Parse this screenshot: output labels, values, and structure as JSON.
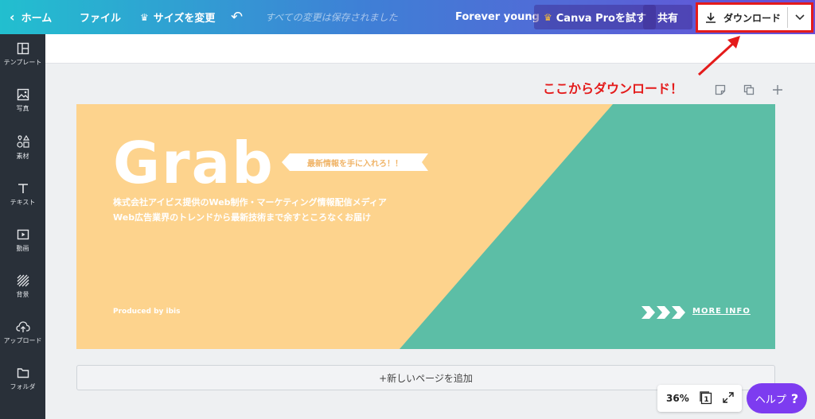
{
  "topbar": {
    "home_label": "ホーム",
    "file_label": "ファイル",
    "resize_label": "サイズを変更",
    "saved_status": "すべての変更は保存されました",
    "doc_title": "Forever young",
    "pro_label": "Canva Proを試す",
    "share_label": "共有",
    "download_label": "ダウンロード"
  },
  "sidebar": {
    "items": [
      {
        "label": "テンプレート",
        "icon": "template-icon"
      },
      {
        "label": "写真",
        "icon": "photo-icon"
      },
      {
        "label": "素材",
        "icon": "elements-icon"
      },
      {
        "label": "テキスト",
        "icon": "text-icon"
      },
      {
        "label": "動画",
        "icon": "video-icon"
      },
      {
        "label": "背景",
        "icon": "background-icon"
      },
      {
        "label": "アップロード",
        "icon": "upload-icon"
      },
      {
        "label": "フォルダ",
        "icon": "folder-icon"
      }
    ]
  },
  "annotation": "ここからダウンロード！",
  "banner": {
    "title": "Grab",
    "ribbon": "最新情報を手に入れろ！！",
    "desc1": "株式会社アイビス提供のWeb制作・マーケティング情報配信メディア",
    "desc2": "Web広告業界のトレンドから最新技術まで余すところなくお届け",
    "produced": "Produced by ibis",
    "more": "MORE INFO",
    "colors": {
      "yellow": "#fdd38d",
      "green": "#5cbea6"
    }
  },
  "add_page_label": "+新しいページを追加",
  "zoom": {
    "value": "36%",
    "page": "1"
  },
  "help_label": "ヘルプ",
  "help_q": "?",
  "colors": {
    "accent_red": "#e41b1b",
    "sidebar": "#293039",
    "help": "#7d3cf0"
  }
}
